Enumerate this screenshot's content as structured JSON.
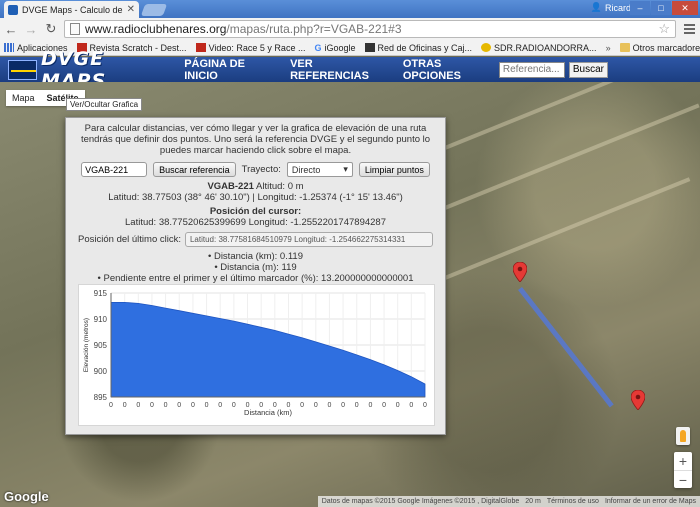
{
  "browser": {
    "tab_title": "DVGE Maps - Calculo de ruta",
    "profile_name": "Ricardo",
    "url_host": "www.radioclubhenares.org",
    "url_path": "/mapas/ruta.php?r=VGAB-221#3",
    "bookmarks": [
      "Aplicaciones",
      "Revista Scratch - Dest...",
      "Video: Race 5 y Race ...",
      "iGoogle",
      "Red de Oficinas y Caj...",
      "SDR.RADIOANDORRA..."
    ],
    "other_bookmarks": "Otros marcadores",
    "more": "»"
  },
  "site": {
    "logo_text": "DVGE MAPS",
    "nav": [
      "PÁGINA DE INICIO",
      "VER REFERENCIAS",
      "OTRAS OPCIONES"
    ],
    "search_placeholder": "Referencia...",
    "search_button": "Buscar"
  },
  "map": {
    "type_buttons": [
      "Mapa",
      "Satélite"
    ],
    "tooltip": "Ver/Ocultar Grafica",
    "google_logo": "Google",
    "attribution": [
      "Datos de mapas ©2015 Google Imágenes ©2015 , DigitalGlobe",
      "20 m",
      "Términos de uso",
      "Informar de un error de Maps"
    ],
    "zoom_in": "+",
    "zoom_out": "−"
  },
  "panel": {
    "intro": "Para calcular distancias, ver cómo llegar y ver la grafica de elevación de una ruta tendrás que definir dos puntos. Uno será la referencia DVGE y el segundo punto lo puedes marcar haciendo click sobre el mapa.",
    "ref_input": "VGAB-221",
    "search_ref_button": "Buscar referencia",
    "route_label": "Trayecto:",
    "route_value": "Directo",
    "clear_button": "Limpiar puntos",
    "ref_name": "VGAB-221",
    "altitude": "Altitud: 0 m",
    "ref_coords": "Latitud: 38.77503 (38° 46' 30.10\") | Longitud: -1.25374 (-1° 15' 13.46\")",
    "cursor_title": "Posición del cursor:",
    "cursor_coords": "Latitud: 38.77520625399699 Longitud: -1.2552201747894287",
    "last_click_label": "Posición del último click:",
    "last_click_value": "Latitud: 38.77581684510979 Longitud: -1.254662275314331",
    "distance_km": "Distancia (km): 0.119",
    "distance_m": "Distancia (m): 119",
    "slope": "Pendiente entre el primer y el último marcador (%): 13.200000000000001"
  },
  "colors": {
    "header": "#1f4593",
    "chart_fill": "#2f6fe0",
    "marker": "#e53935",
    "route": "#5078e6"
  },
  "chart_data": {
    "type": "area",
    "xlabel": "Distancia (km)",
    "ylabel": "Elevación (metros)",
    "ylim": [
      895,
      915
    ],
    "yticks": [
      895,
      900,
      905,
      910,
      915
    ],
    "x_tick_labels": [
      "0",
      "0",
      "0",
      "0",
      "0",
      "0",
      "0",
      "0",
      "0",
      "0",
      "0",
      "0",
      "0",
      "0",
      "0",
      "0",
      "0",
      "0",
      "0",
      "0",
      "0",
      "0",
      "0",
      "0"
    ],
    "values": [
      913.2,
      913.2,
      913.0,
      912.6,
      912.1,
      911.6,
      911.1,
      910.6,
      910.1,
      909.6,
      909.0,
      908.4,
      907.8,
      907.1,
      906.4,
      905.6,
      904.8,
      904.0,
      903.1,
      902.2,
      901.2,
      900.1,
      898.9,
      897.5
    ],
    "grid": true
  }
}
